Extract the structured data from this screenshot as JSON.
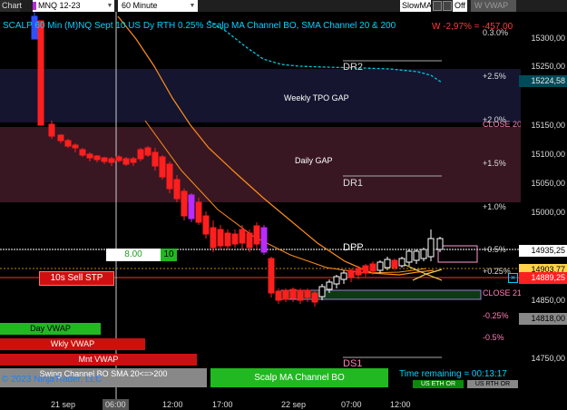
{
  "toolbar": {
    "chart_tab": "Chart",
    "instrument": "MNQ 12-23",
    "period": "60 Minute",
    "ma_select": "SlowMA",
    "off_select": "Off",
    "vwap_button": "W VWAP"
  },
  "chart": {
    "title": "SCALP 60 Min (M)NQ Sept 10  US Dy RTH 0.25%  Scalp MA Channel BO, SMA Channel 20 & 200",
    "pnl": "W -2,97% = -457.00",
    "zone_labels": {
      "dr2": "DR2",
      "weekly_gap": "Weekly TPO GAP",
      "close20": "CLOSE 20",
      "daily_gap": "Daily GAP",
      "dr1": "DR1",
      "dpp": "DPP",
      "close21": "CLOSE 21",
      "ds1": "DS1"
    },
    "pct_labels": [
      "0.3.0%",
      "+2.5%",
      "+2.0%",
      "+1.5%",
      "+1.0%",
      "+0.5%",
      "+0.25%",
      "-0.25%",
      "-0.5%"
    ],
    "order_qty": "8.00",
    "order_count": "10",
    "sell_stop": "10s Sell STP",
    "buttons": {
      "day_vwap": "Day VWAP",
      "wkly_vwap": "Wkly VWAP",
      "mnt_vwap": "Mnt VWAP",
      "swing": "Swing Channel BO  SMA 20<=>200",
      "scalp": "Scalp MA Channel BO",
      "us_eth": "US ETH OR",
      "us_rth": "US RTH OR"
    },
    "copyright": "© 2023 NinjaTrader, LLC",
    "time_remaining": "Time remaining = 00:13:17"
  },
  "price_axis": {
    "ticks": [
      "15300,00",
      "15250,00",
      "15150,00",
      "15100,00",
      "15050,00",
      "15000,00",
      "14850,00",
      "14750,00"
    ],
    "tags": [
      {
        "value": "15224,58",
        "bg": "#004b5a",
        "fg": "#e8e8e8"
      },
      {
        "value": "14935,25",
        "bg": "#ffffff",
        "fg": "#000000"
      },
      {
        "value": "14903,77",
        "bg": "#ffd24a",
        "fg": "#000000"
      },
      {
        "value": "14889,25",
        "bg": "#ff2020",
        "fg": "#ffffff"
      },
      {
        "value": "14818,00",
        "bg": "#888888",
        "fg": "#000000"
      }
    ]
  },
  "time_axis": {
    "labels": [
      "21 sep",
      "06:00",
      "12:00",
      "17:00",
      "22 sep",
      "07:00",
      "12:00"
    ]
  },
  "colors": {
    "up": "#ffffff",
    "down": "#ff1f1f",
    "sma_fast": "#ff8c1a",
    "sma_slow": "#00c8d8",
    "gap_weekly": "#151530",
    "gap_daily": "#381722"
  }
}
